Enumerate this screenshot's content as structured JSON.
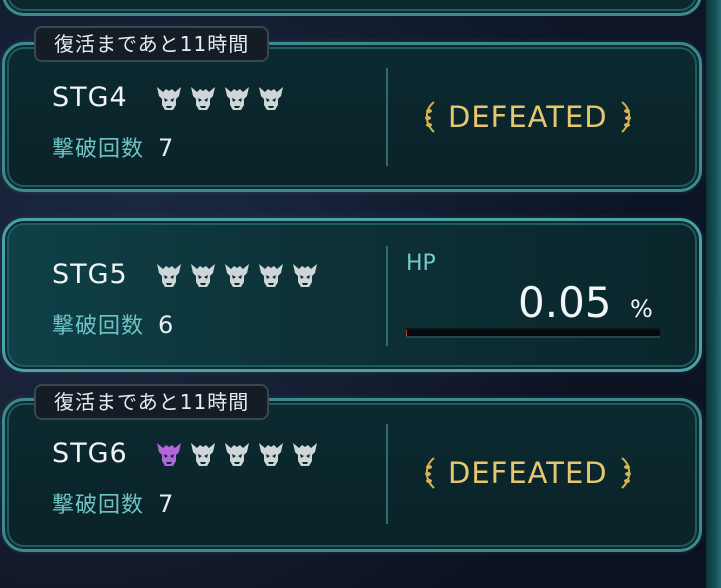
{
  "colors": {
    "defeated_gold": "#e6c770",
    "kills_label": "#6fc3c6",
    "frame_teal": "#3c8a8e",
    "skull_inactive": "#cfd6d8",
    "skull_active": "#b266d9"
  },
  "stages": [
    {
      "revive_tag": "復活まであと11時間",
      "name": "STG4",
      "difficulty_icons": [
        "demon-skull-icon",
        "demon-skull-icon",
        "demon-skull-icon",
        "demon-skull-icon"
      ],
      "kills_label": "撃破回数",
      "kills_value": "7",
      "status": "DEFEATED"
    },
    {
      "name": "STG5",
      "difficulty_icons": [
        "demon-skull-icon",
        "demon-skull-icon",
        "demon-skull-icon",
        "demon-skull-icon",
        "demon-skull-icon"
      ],
      "kills_label": "撃破回数",
      "kills_value": "6",
      "hp_label": "HP",
      "hp_value": "0.05",
      "hp_unit": "%",
      "hp_fraction": 0.0005
    },
    {
      "revive_tag": "復活まであと11時間",
      "name": "STG6",
      "difficulty_icons": [
        "demon-skull-icon-purple",
        "demon-skull-icon",
        "demon-skull-icon",
        "demon-skull-icon",
        "demon-skull-icon"
      ],
      "kills_label": "撃破回数",
      "kills_value": "7",
      "status": "DEFEATED"
    }
  ]
}
